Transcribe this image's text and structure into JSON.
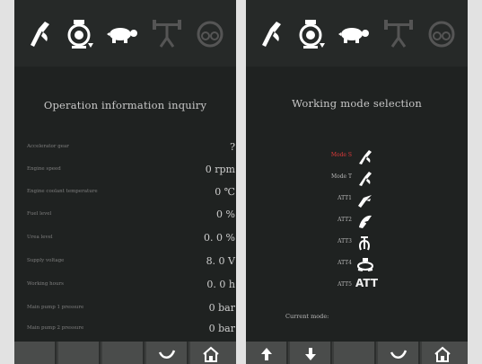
{
  "left_panel": {
    "top_icons": [
      "work-mode-icon",
      "engine-filter-icon",
      "turtle-slow-icon",
      "weight-limit-icon",
      "gear-icon"
    ],
    "title": "Operation information inquiry",
    "rows": [
      {
        "label": "Accelerator gear",
        "value": "?"
      },
      {
        "label": "Engine speed",
        "value": "0 rpm"
      },
      {
        "label": "Engine coolant temperature",
        "value": "0 ℃"
      },
      {
        "label": "Fuel level",
        "value": "0 %"
      },
      {
        "label": "Urea level",
        "value": "0. 0 %"
      },
      {
        "label": "Supply voltage",
        "value": "8. 0 V"
      },
      {
        "label": "Working hours",
        "value": "0. 0 h"
      },
      {
        "label": "Main pump 1 pressure",
        "value": "0 bar"
      },
      {
        "label": "Main pump 2 pressure",
        "value": "0 bar"
      }
    ],
    "bottom_buttons": [
      "blank",
      "blank",
      "blank",
      "confirm-check-icon",
      "home-icon"
    ]
  },
  "right_panel": {
    "top_icons": [
      "work-mode-icon",
      "engine-filter-icon",
      "turtle-slow-icon",
      "weight-limit-icon",
      "gear-icon"
    ],
    "title": "Working mode selection",
    "modes": [
      {
        "label": "Mode S",
        "icon": "shovel-icon",
        "active": true
      },
      {
        "label": "Mode T",
        "icon": "shovel-icon",
        "active": false
      },
      {
        "label": "ATT1",
        "icon": "hammer-icon",
        "active": false
      },
      {
        "label": "ATT2",
        "icon": "shear-icon",
        "active": false
      },
      {
        "label": "ATT3",
        "icon": "grapple-icon",
        "active": false
      },
      {
        "label": "ATT4",
        "icon": "tiltrotator-icon",
        "active": false
      },
      {
        "label": "ATT5",
        "icon_text": "ATT",
        "active": false
      }
    ],
    "current_mode_label": "Current mode:",
    "bottom_buttons": [
      "up-arrow-icon",
      "down-arrow-icon",
      "blank",
      "confirm-check-icon",
      "home-icon"
    ]
  },
  "colors": {
    "panel_bg": "#1f2221",
    "active_mode": "#e03b3b",
    "text": "#c8c8c8"
  }
}
